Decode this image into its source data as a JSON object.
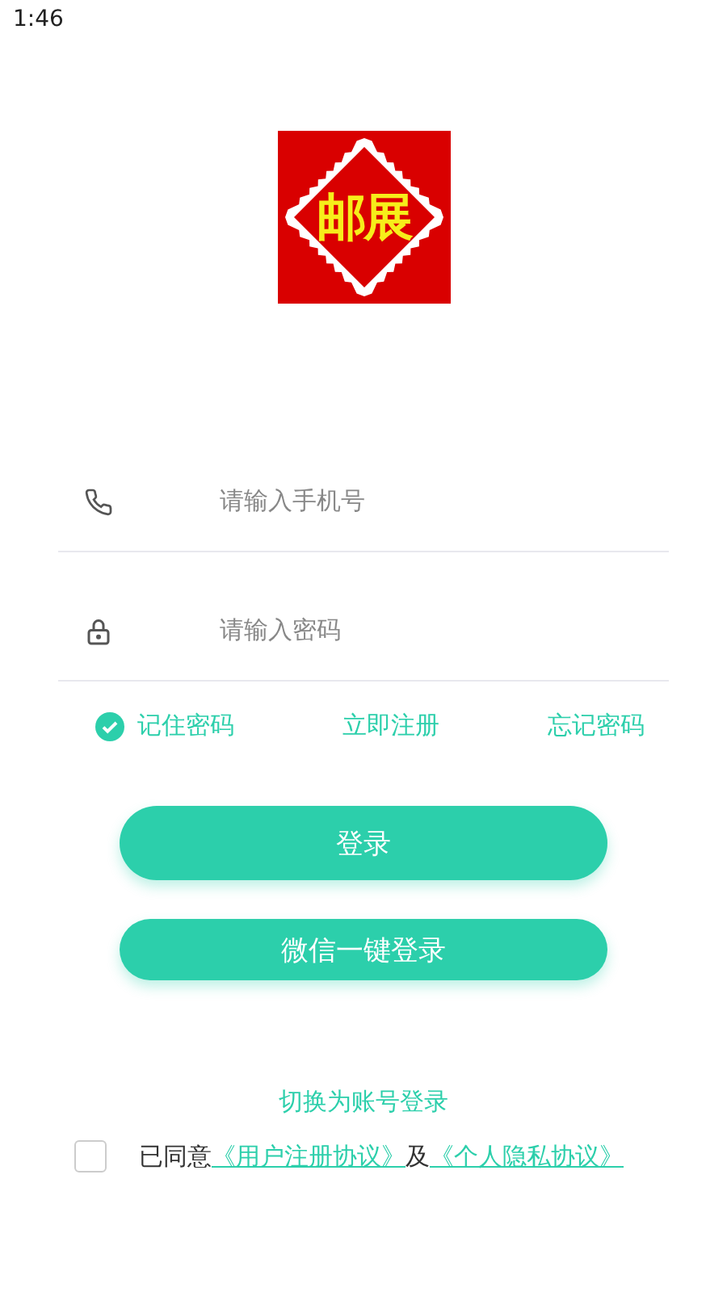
{
  "status_bar": {
    "time": "1:46"
  },
  "logo": {
    "text": "邮展"
  },
  "phone_field": {
    "placeholder": "请输入手机号"
  },
  "password_field": {
    "placeholder": "请输入密码"
  },
  "remember_password": {
    "label": "记住密码",
    "checked": true
  },
  "register_link": "立即注册",
  "forgot_link": "忘记密码",
  "login_button": "登录",
  "wechat_button": "微信一键登录",
  "switch_link": "切换为账号登录",
  "agreement": {
    "checked": false,
    "prefix": "已同意",
    "link_1": "《用户注册协议》",
    "joiner": "及",
    "link_2": "《个人隐私协议》"
  }
}
